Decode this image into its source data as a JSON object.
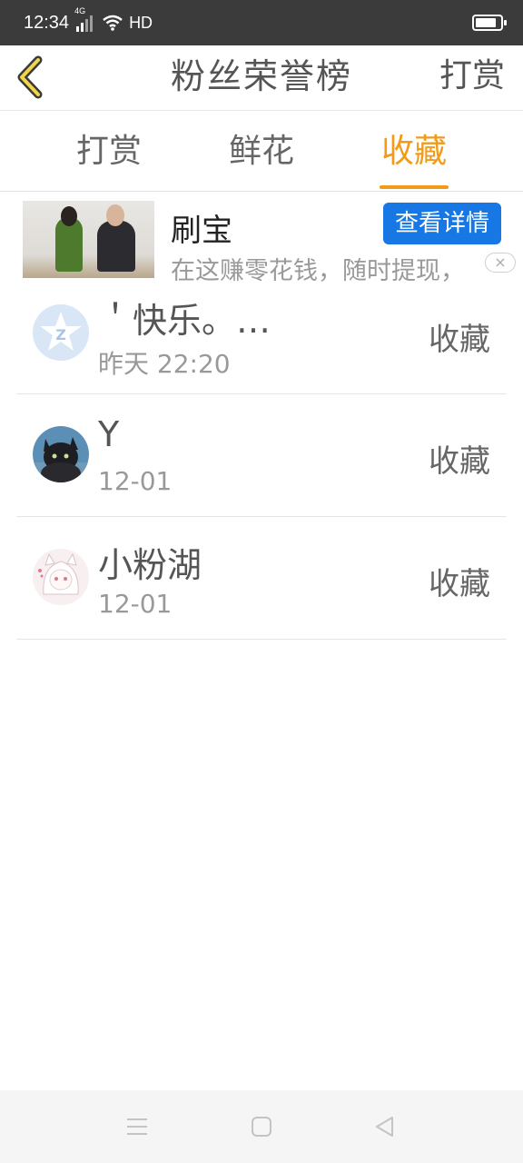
{
  "status_bar": {
    "time": "12:34",
    "network": "4G",
    "hd_label": "HD"
  },
  "header": {
    "title": "粉丝荣誉榜",
    "action_label": "打赏"
  },
  "tabs": [
    {
      "label": "打赏",
      "active": false
    },
    {
      "label": "鲜花",
      "active": false
    },
    {
      "label": "收藏",
      "active": true
    }
  ],
  "ad": {
    "title": "刷宝",
    "description": "在这赚零花钱，随时提现，",
    "detail_button": "查看详情",
    "close_symbol": "×"
  },
  "list": [
    {
      "name": "＇快乐。…",
      "time": "昨天 22:20",
      "action": "收藏",
      "avatar_icon": "qq-star-avatar"
    },
    {
      "name": "Y",
      "time": "12-01",
      "action": "收藏",
      "avatar_icon": "cat-avatar"
    },
    {
      "name": "小粉湖",
      "time": "12-01",
      "action": "收藏",
      "avatar_icon": "anime-girl-avatar"
    }
  ],
  "colors": {
    "accent": "#f29a19",
    "button_blue": "#1677e5",
    "status_bar": "#3b3b3b"
  }
}
